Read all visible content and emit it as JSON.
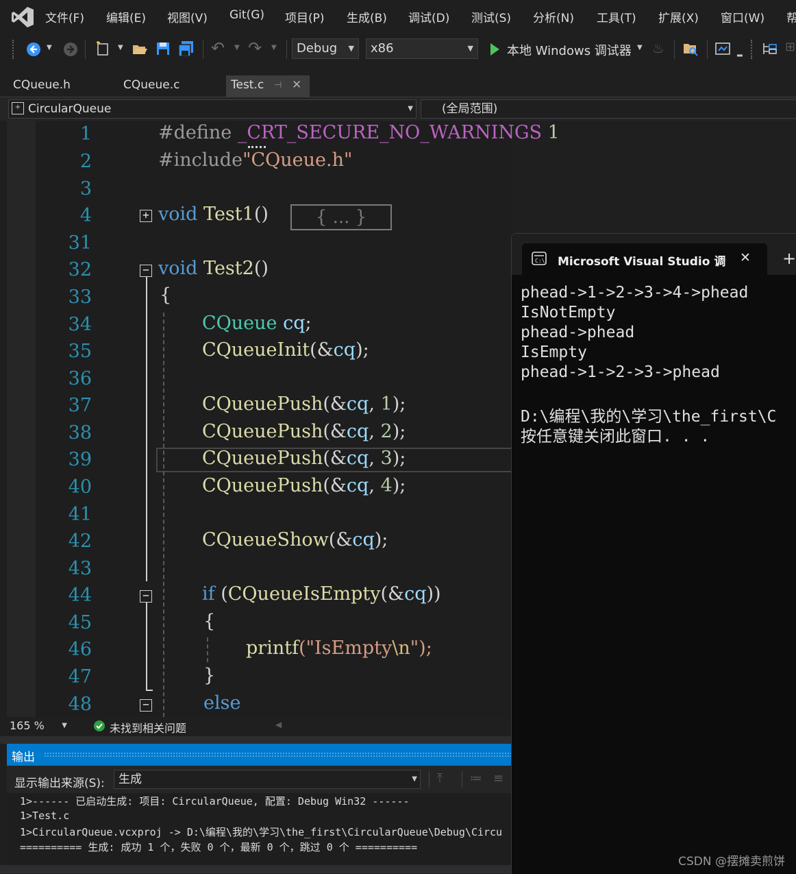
{
  "menu": [
    "文件(F)",
    "编辑(E)",
    "视图(V)",
    "Git(G)",
    "项目(P)",
    "生成(B)",
    "调试(D)",
    "测试(S)",
    "分析(N)",
    "工具(T)",
    "扩展(X)",
    "窗口(W)",
    "帮"
  ],
  "toolbar": {
    "config": "Debug",
    "platform": "x86",
    "run_label": "本地 Windows 调试器"
  },
  "tabs": [
    "CQueue.h",
    "CQueue.c",
    "Test.c"
  ],
  "navbar": {
    "project": "CircularQueue",
    "scope": "(全局范围)"
  },
  "line_numbers": [
    "1",
    "2",
    "3",
    "4",
    "31",
    "32",
    "33",
    "34",
    "35",
    "36",
    "37",
    "38",
    "39",
    "40",
    "41",
    "42",
    "43",
    "44",
    "45",
    "46",
    "47",
    "48"
  ],
  "code": {
    "l1_directive": "#define ",
    "l1_macro": "_CRT_SECURE_NO_WARNINGS",
    "l1_value": " 1",
    "l2_directive": "#include",
    "l2_file": "\"CQueue.h\"",
    "l4_kw": "void",
    "l4_fn": "Test1",
    "l4_paren": "()",
    "collapsed": "{ ... }",
    "l32_kw": "void",
    "l32_fn": "Test2",
    "l32_paren": "()",
    "brace_open": "{",
    "brace_close": "}",
    "l34_type": "CQueue",
    "l34_var": "cq",
    "l34_semi": ";",
    "init_fn": "CQueueInit",
    "push_fn": "CQueuePush",
    "show_fn": "CQueueShow",
    "isempty_fn": "CQueueIsEmpty",
    "printf_fn": "printf",
    "arg_ref_open": "(&",
    "arg_var": "cq",
    "arg_close": ");",
    "comma": ", ",
    "push_vals": [
      "1",
      "2",
      "3",
      "4"
    ],
    "if_kw": "if",
    "if_open": " (",
    "if_close": "))",
    "str_open": "(\"IsEmpty",
    "str_esc": "\\n",
    "str_close": "\");",
    "else_kw": "else"
  },
  "status": {
    "zoom": "165 %",
    "issues": "未找到相关问题"
  },
  "output": {
    "title": "输出",
    "source_label": "显示输出来源(S):",
    "source_value": "生成",
    "lines": [
      "1>------ 已启动生成: 项目: CircularQueue, 配置: Debug Win32 ------",
      "1>Test.c",
      "1>CircularQueue.vcxproj -> D:\\编程\\我的\\学习\\the_first\\CircularQueue\\Debug\\Circu",
      "========== 生成: 成功 1 个，失败 0 个，最新 0 个，跳过 0 个 =========="
    ]
  },
  "console": {
    "tab_title": "Microsoft Visual Studio 调试控",
    "lines": [
      "phead->1->2->3->4->phead",
      "IsNotEmpty",
      "phead->phead",
      "IsEmpty",
      "phead->1->2->3->phead",
      "",
      "D:\\编程\\我的\\学习\\the_first\\C",
      "按任意键关闭此窗口. . ."
    ]
  },
  "watermark": "CSDN @摆摊卖煎饼",
  "colors": {
    "accent": "#007acc",
    "keyword": "#569cd6",
    "type": "#4ec9b0",
    "function": "#dcdcaa",
    "string": "#d69d85",
    "linenumber": "#2b91af"
  }
}
